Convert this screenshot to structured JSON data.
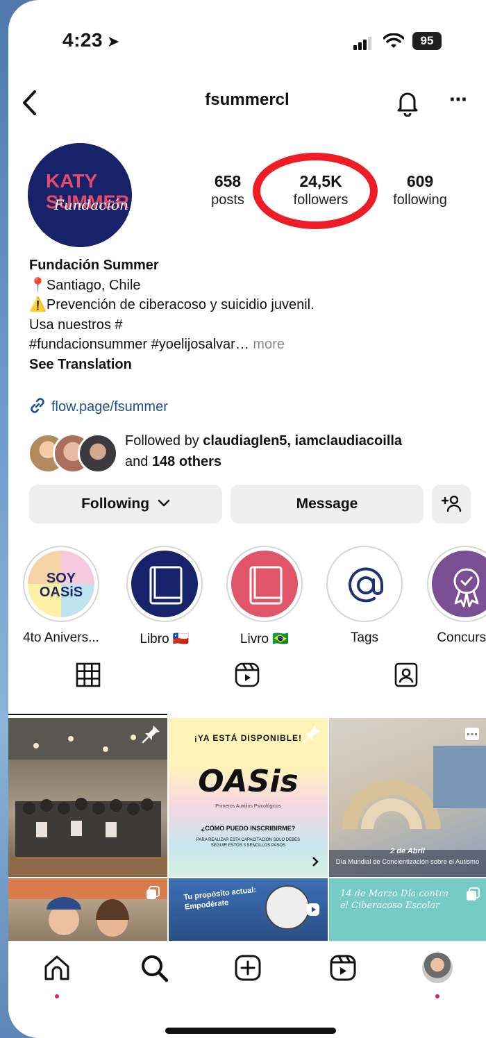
{
  "status_bar": {
    "time": "4:23",
    "battery": "95"
  },
  "header": {
    "username": "fsummercl"
  },
  "profile": {
    "avatar_text_top": "KATY",
    "avatar_text_bottom": "SUMMER",
    "avatar_script": "Fundación",
    "stats": [
      {
        "value": "658",
        "label": "posts"
      },
      {
        "value": "24,5K",
        "label": "followers"
      },
      {
        "value": "609",
        "label": "following"
      }
    ]
  },
  "bio": {
    "name": "Fundación Summer",
    "location": "Santiago, Chile",
    "line2": "Prevención de ciberacoso y suicidio juvenil.",
    "line3": "Usa nuestros #",
    "line4": "#fundacionsummer #yoelijosalvar…",
    "more": "more",
    "see_translation": "See Translation",
    "link": "flow.page/fsummer"
  },
  "followed_by": {
    "prefix": "Followed by ",
    "names": "claudiaglen5, iamclaudiacoilla",
    "and": "and ",
    "others": "148 others"
  },
  "buttons": {
    "following": "Following",
    "message": "Message"
  },
  "highlights": [
    {
      "label": "4to Anivers...",
      "badge": "SOY OASIS"
    },
    {
      "label": "Libro",
      "flag": "🇨🇱"
    },
    {
      "label": "Livro",
      "flag": "🇧🇷"
    },
    {
      "label": "Tags"
    },
    {
      "label": "Concurso"
    }
  ],
  "posts": {
    "oasis_top": "¡YA ESTÁ DISPONIBLE!",
    "oasis_title": "OASis",
    "oasis_subtitle": "Primeros Auxilios Psicológicos",
    "oasis_question": "¿CÓMO PUEDO INSCRIBIRME?",
    "oasis_body": "PARA REALIZAR ESTA CAPACITACIÓN SOLO DEBES SEGUIR ESTOS 3 SENCILLOS PASOS",
    "autism_date": "2 de Abril",
    "autism_text": "Día Mundial de Concientización sobre el Autismo",
    "post5_text": "Tu propósito actual: Empodérate",
    "post6_text": "14 de Marzo Día contra el Ciberacoso Escolar"
  },
  "colors": {
    "highlight_ring": "#ee1c24",
    "avatar_bg": "#16236b",
    "link": "#1d4e8f",
    "notification_dot": "#e0245e"
  },
  "icons": [
    "signal-icon",
    "wifi-icon",
    "back-icon",
    "bell-icon",
    "more-icon",
    "link-icon",
    "chevron-down-icon",
    "add-person-icon",
    "grid-icon",
    "reels-icon",
    "tagged-icon",
    "home-icon",
    "search-icon",
    "create-icon",
    "reels-nav-icon",
    "profile-avatar"
  ]
}
